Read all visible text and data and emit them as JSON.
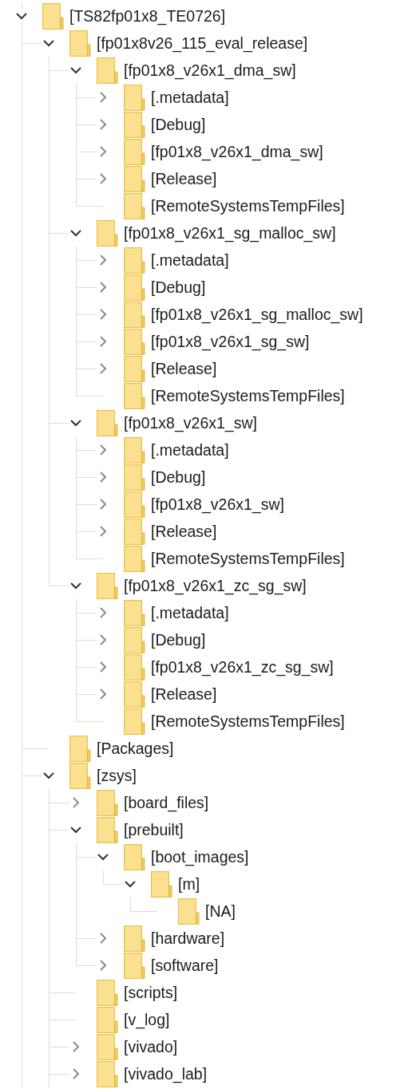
{
  "tree": [
    {
      "label": "[TS82fp01x8_TE0726]",
      "expanded": true,
      "children": [
        {
          "label": "[fp01x8v26_115_eval_release]",
          "expanded": true,
          "children": [
            {
              "label": "[fp01x8_v26x1_dma_sw]",
              "expanded": true,
              "children": [
                {
                  "label": "[.metadata]",
                  "expanded": false
                },
                {
                  "label": "[Debug]",
                  "expanded": false
                },
                {
                  "label": "[fp01x8_v26x1_dma_sw]",
                  "expanded": false
                },
                {
                  "label": "[Release]",
                  "expanded": false
                },
                {
                  "label": "[RemoteSystemsTempFiles]"
                }
              ]
            },
            {
              "label": "[fp01x8_v26x1_sg_malloc_sw]",
              "expanded": true,
              "children": [
                {
                  "label": "[.metadata]",
                  "expanded": false
                },
                {
                  "label": "[Debug]",
                  "expanded": false
                },
                {
                  "label": "[fp01x8_v26x1_sg_malloc_sw]",
                  "expanded": false
                },
                {
                  "label": "[fp01x8_v26x1_sg_sw]",
                  "expanded": false
                },
                {
                  "label": "[Release]",
                  "expanded": false
                },
                {
                  "label": "[RemoteSystemsTempFiles]"
                }
              ]
            },
            {
              "label": "[fp01x8_v26x1_sw]",
              "expanded": true,
              "children": [
                {
                  "label": "[.metadata]",
                  "expanded": false
                },
                {
                  "label": "[Debug]",
                  "expanded": false
                },
                {
                  "label": "[fp01x8_v26x1_sw]",
                  "expanded": false
                },
                {
                  "label": "[Release]",
                  "expanded": false
                },
                {
                  "label": "[RemoteSystemsTempFiles]"
                }
              ]
            },
            {
              "label": "[fp01x8_v26x1_zc_sg_sw]",
              "expanded": true,
              "children": [
                {
                  "label": "[.metadata]",
                  "expanded": false
                },
                {
                  "label": "[Debug]",
                  "expanded": false
                },
                {
                  "label": "[fp01x8_v26x1_zc_sg_sw]",
                  "expanded": false
                },
                {
                  "label": "[Release]",
                  "expanded": false
                },
                {
                  "label": "[RemoteSystemsTempFiles]"
                }
              ]
            }
          ]
        },
        {
          "label": "[Packages]"
        },
        {
          "label": "[zsys]",
          "expanded": true,
          "children": [
            {
              "label": "[board_files]",
              "expanded": false
            },
            {
              "label": "[prebuilt]",
              "expanded": true,
              "children": [
                {
                  "label": "[boot_images]",
                  "expanded": true,
                  "children": [
                    {
                      "label": "[m]",
                      "expanded": true,
                      "children": [
                        {
                          "label": "[NA]"
                        }
                      ]
                    }
                  ]
                },
                {
                  "label": "[hardware]",
                  "expanded": false
                },
                {
                  "label": "[software]",
                  "expanded": false
                }
              ]
            },
            {
              "label": "[scripts]"
            },
            {
              "label": "[v_log]"
            },
            {
              "label": "[vivado]",
              "expanded": false
            },
            {
              "label": "[vivado_lab]",
              "expanded": false
            }
          ]
        }
      ]
    }
  ]
}
